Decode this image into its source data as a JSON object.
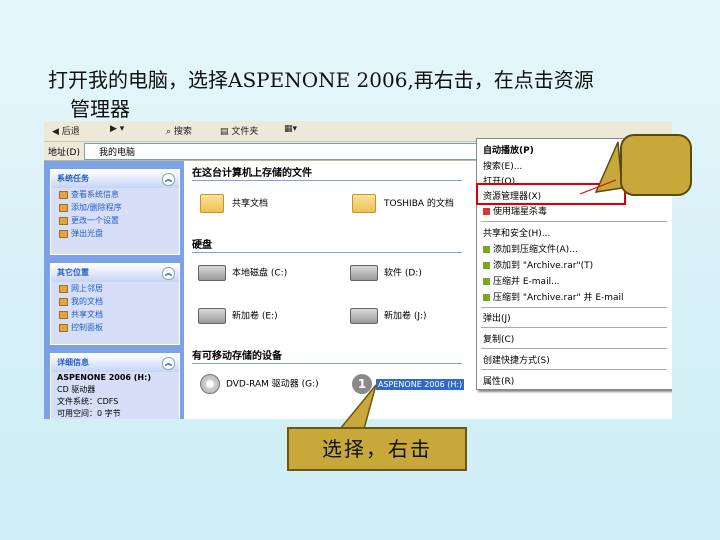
{
  "slide": {
    "title_line1": "打开我的电脑，选择ASPENONE 2006,再右击，在点击资源",
    "title_line2": "管理器",
    "callout_text": "选择，右击"
  },
  "toolbar": {
    "back": "后退",
    "search": "搜索",
    "folders": "文件夹",
    "views": "▦▾"
  },
  "address": {
    "label": "地址(D)",
    "value": "我的电脑"
  },
  "left_pane": {
    "system_tasks": {
      "title": "系统任务",
      "items": [
        "查看系统信息",
        "添加/删除程序",
        "更改一个设置",
        "弹出光盘"
      ]
    },
    "other_places": {
      "title": "其它位置",
      "items": [
        "网上邻居",
        "我的文档",
        "共享文档",
        "控制面板"
      ]
    },
    "details": {
      "title": "详细信息",
      "lines": [
        "ASPENONE 2006 (H:)",
        "CD 驱动器",
        "文件系统：CDFS",
        "可用空间：0 字节"
      ]
    }
  },
  "content": {
    "section_files": "在这台计算机上存储的文件",
    "shared_docs": "共享文档",
    "user_docs": "TOSHIBA 的文档",
    "section_drives": "硬盘",
    "drive_c": "本地磁盘 (C:)",
    "drive_d": "软件 (D:)",
    "drive_e": "新加卷 (E:)",
    "drive_j": "新加卷 (J:)",
    "section_removable": "有可移动存储的设备",
    "dvd_drive": "DVD-RAM 驱动器 (G:)",
    "aspen_drive": "ASPENONE 2006 (H:)"
  },
  "context_menu": {
    "items": [
      {
        "label": "自动播放(P)",
        "bold": true
      },
      {
        "label": "搜索(E)..."
      },
      {
        "label": "打开(O)"
      },
      {
        "label": "资源管理器(X)"
      },
      {
        "label": "使用瑞星杀毒"
      },
      {
        "label": "共享和安全(H)..."
      },
      {
        "label": "添加到压缩文件(A)..."
      },
      {
        "label": "添加到 \"Archive.rar\"(T)"
      },
      {
        "label": "压缩并 E-mail..."
      },
      {
        "label": "压缩到 \"Archive.rar\" 并 E-mail"
      },
      {
        "label": "弹出(J)"
      },
      {
        "label": "复制(C)"
      },
      {
        "label": "创建快捷方式(S)"
      },
      {
        "label": "属性(R)"
      }
    ]
  },
  "colors": {
    "background": "#d6f0f7",
    "callout": "#c8a839",
    "highlight": "#dd0000",
    "xp_blue": "#7ba2e7"
  }
}
